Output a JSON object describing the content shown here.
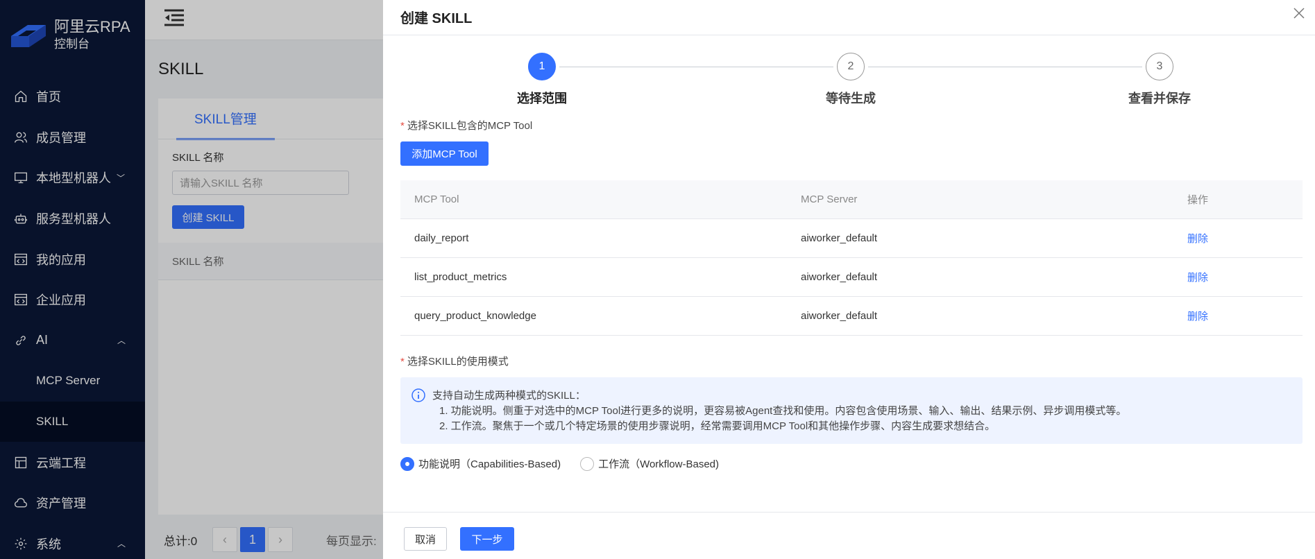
{
  "brand": {
    "name": "阿里云RPA",
    "sub": "控制台"
  },
  "sidebar": {
    "items": [
      {
        "label": "首页"
      },
      {
        "label": "成员管理"
      },
      {
        "label": "本地型机器人"
      },
      {
        "label": "服务型机器人"
      },
      {
        "label": "我的应用"
      },
      {
        "label": "企业应用"
      },
      {
        "label": "AI"
      },
      {
        "label": "MCP Server"
      },
      {
        "label": "SKILL"
      },
      {
        "label": "云端工程"
      },
      {
        "label": "资产管理"
      },
      {
        "label": "系统"
      }
    ]
  },
  "page": {
    "title": "SKILL",
    "tab": "SKILL管理",
    "field_label": "SKILL 名称",
    "field_placeholder": "请输入SKILL 名称",
    "create_button": "创建 SKILL",
    "table_header": "SKILL 名称",
    "pager": {
      "total": "总计:0",
      "current": "1",
      "per_page": "每页显示:"
    }
  },
  "drawer": {
    "title": "创建 SKILL",
    "steps": [
      {
        "num": "1",
        "label": "选择范围"
      },
      {
        "num": "2",
        "label": "等待生成"
      },
      {
        "num": "3",
        "label": "查看并保存"
      }
    ],
    "section1_label": "选择SKILL包含的MCP Tool",
    "add_button": "添加MCP Tool",
    "table": {
      "headers": [
        "MCP Tool",
        "MCP Server",
        "操作"
      ],
      "rows": [
        {
          "tool": "daily_report",
          "server": "aiworker_default",
          "action": "删除"
        },
        {
          "tool": "list_product_metrics",
          "server": "aiworker_default",
          "action": "删除"
        },
        {
          "tool": "query_product_knowledge",
          "server": "aiworker_default",
          "action": "删除"
        }
      ]
    },
    "section2_label": "选择SKILL的使用模式",
    "info": {
      "line1": "支持自动生成两种模式的SKILL：",
      "line2": "1. 功能说明。侧重于对选中的MCP Tool进行更多的说明，更容易被Agent查找和使用。内容包含使用场景、输入、输出、结果示例、异步调用模式等。",
      "line3": "2. 工作流。聚焦于一个或几个特定场景的使用步骤说明，经常需要调用MCP Tool和其他操作步骤、内容生成要求想结合。"
    },
    "modes": [
      {
        "label": "功能说明（Capabilities-Based)"
      },
      {
        "label": "工作流（Workflow-Based)"
      }
    ],
    "cancel": "取消",
    "next": "下一步"
  }
}
